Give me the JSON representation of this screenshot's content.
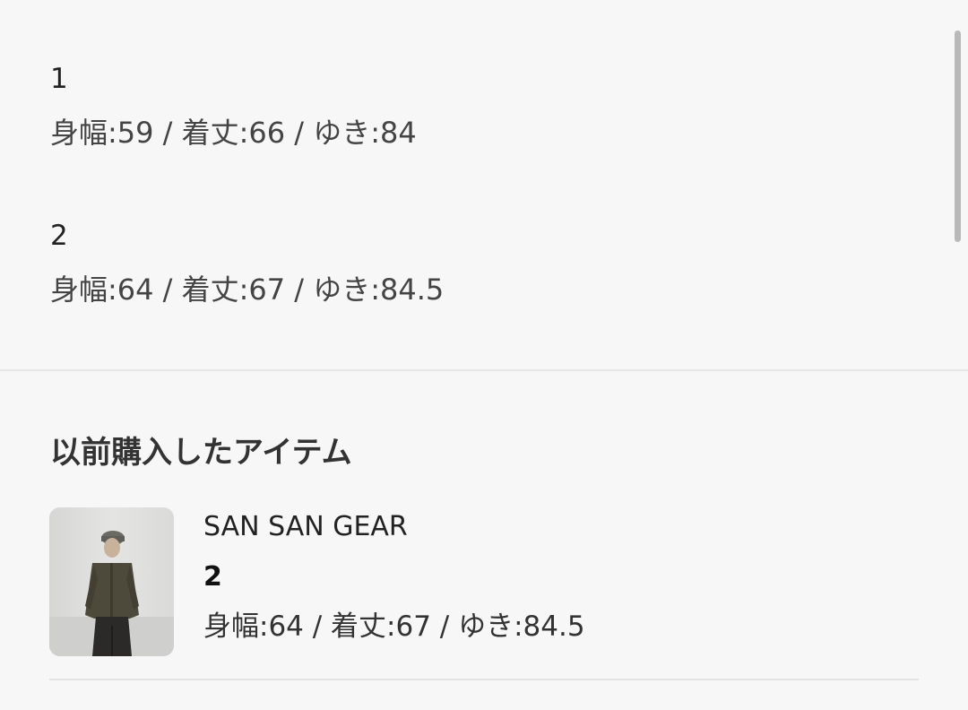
{
  "sizes": [
    {
      "name": "1",
      "measurements": "身幅:59 / 着丈:66 / ゆき:84"
    },
    {
      "name": "2",
      "measurements": "身幅:64 / 着丈:67 / ゆき:84.5"
    }
  ],
  "previous_purchases": {
    "title": "以前購入したアイテム",
    "items": [
      {
        "brand": "SAN SAN GEAR",
        "size": "2",
        "measurements": "身幅:64 / 着丈:67 / ゆき:84.5"
      }
    ]
  }
}
